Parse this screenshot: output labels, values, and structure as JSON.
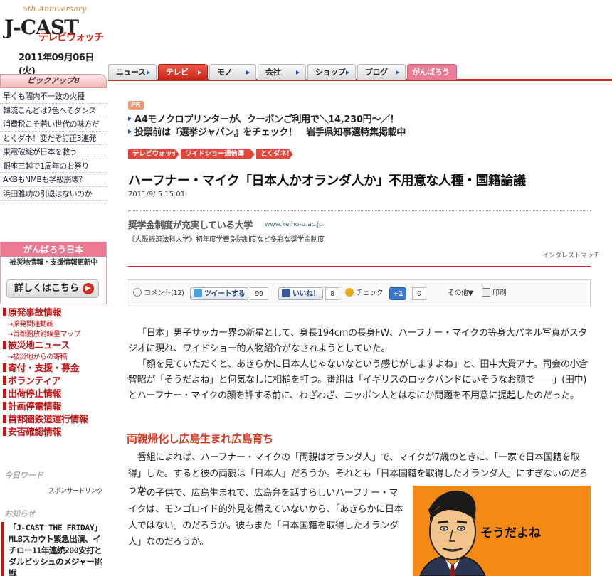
{
  "header": {
    "anniversary": "5th Anniversary",
    "logo_main": "J-CAST",
    "logo_sub": "テレビウォッチ",
    "date": "2011年09月06日(火)"
  },
  "nav": {
    "tabs": [
      "ニュース",
      "テレビ",
      "モノ",
      "会社",
      "ショップ",
      "ブログ",
      "がんばろう日本"
    ],
    "active": "テレビ"
  },
  "pickup": {
    "heading": "ピックアップ8",
    "items": [
      "早くも閣内不一致の火種",
      "韓流こんどは7色へそダンス",
      "消費税こそ若い世代の味方だ",
      "とくダネ！変だぞ訂正3連発",
      "東電破綻が日本を救う",
      "銀座三越で1周年のお祭り",
      "AKBもNMBも学級崩壊？",
      "浜田雅功の引退はないのか"
    ]
  },
  "ganbaro": {
    "heading": "がんばろう日本",
    "sub": "被災地情報・支援情報更新中",
    "button": "詳しくはこちら",
    "arrow": "▶"
  },
  "disaster_links": [
    {
      "kind": "main",
      "label": "原発事故情報"
    },
    {
      "kind": "sub",
      "label": "→原発関連動画"
    },
    {
      "kind": "sub",
      "label": "→首都圏放射線量マップ"
    },
    {
      "kind": "main",
      "label": "被災地ニュース"
    },
    {
      "kind": "sub",
      "label": "→被災地からの寄稿"
    },
    {
      "kind": "main",
      "label": "寄付・支援・募金"
    },
    {
      "kind": "main",
      "label": "ボランティア"
    },
    {
      "kind": "main",
      "label": "出荷停止情報"
    },
    {
      "kind": "main",
      "label": "計画停電情報"
    },
    {
      "kind": "main",
      "label": "首都圏鉄道運行情報"
    },
    {
      "kind": "main",
      "label": "安否確認情報"
    }
  ],
  "sidebar_bottom": {
    "today_word": "今日ワード",
    "sponsored": "スポンサードリンク",
    "news_heading": "お知らせ",
    "news_text": "「J-CAST THE FRIDAY」 MLBスカウト緊急出演、イチロー11年連続200安打とダルビッシュのメジャー挑戦"
  },
  "pr": {
    "badge": "PR",
    "line1": "A4モノクロプリンターが、クーポンご利用で＼14,230円～／！",
    "line2": "投票前は『選挙ジャパン』をチェック！　岩手県知事選特集掲載中"
  },
  "breadcrumbs": [
    "テレビウォッチ",
    "ワイドショー通信簿",
    "とくダネ！"
  ],
  "article": {
    "title": "ハーフナー・マイク「日本人かオランダ人か」不用意な人種・国籍論議",
    "timestamp": "2011/9/ 5 15:01",
    "paragraphs": [
      "「日本」男子サッカー界の新星として、身長194cmの長身FW、ハーフナー・マイクの等身大パネル写真がスタジオに現れ、ワイドショー的人物紹介がなされようとしていた。",
      "「顔を見ていただくと、あきらかに日本人じゃないなという感じがしますよね」と、田中大貴アナ。司会の小倉智昭が「そうだよね」と何気なしに相槌を打つ。番組は「イギリスのロックバンドにいそうなお顔で――」(田中)とハーフナー・マイクの顔を評する前に、わざわざ、ニッポン人とはなにか問題を不用意に提起したのだった。"
    ],
    "subheading": "両親帰化し広島生まれ広島育ち",
    "paragraph3": "番組によれば、ハーフナー・マイクの「両親はオランダ人」で、マイクが7歳のときに、「一家で日本国籍を取得」した。すると彼の両親は「日本人」だろうか。それとも「日本国籍を取得したオランダ人」にすぎないのだろうか。",
    "paragraph4": "その子供で、広島生まれで、広島弁を話すらしいハーフナー・マイクは、モンゴロイド的外見を備えていないから、「あきらかに日本人ではない」のだろうか。彼もまた「日本国籍を取得したオランダ人」なのだろうか。",
    "illustration_caption": "そうだよね"
  },
  "ad": {
    "title": "奨学金制度が充実している大学",
    "url": "www.keiho-u.ac.jp",
    "desc": "《大阪経済法科大学》初年度学費免除制度など多彩な奨学金制度",
    "credit": "インタレストマッチ"
  },
  "share": {
    "comment": "コメント(12)",
    "tweet": "ツイートする",
    "tweet_count": "99",
    "like": "いいね！",
    "like_count": "8",
    "check": "チェック",
    "plusone": "+1",
    "plusone_count": "0",
    "other": "その他▼",
    "print": "印刷"
  },
  "colors": {
    "brand_red": "#d42d1e",
    "pink": "#eb7c93",
    "illustration_bg": "#f28a14"
  }
}
